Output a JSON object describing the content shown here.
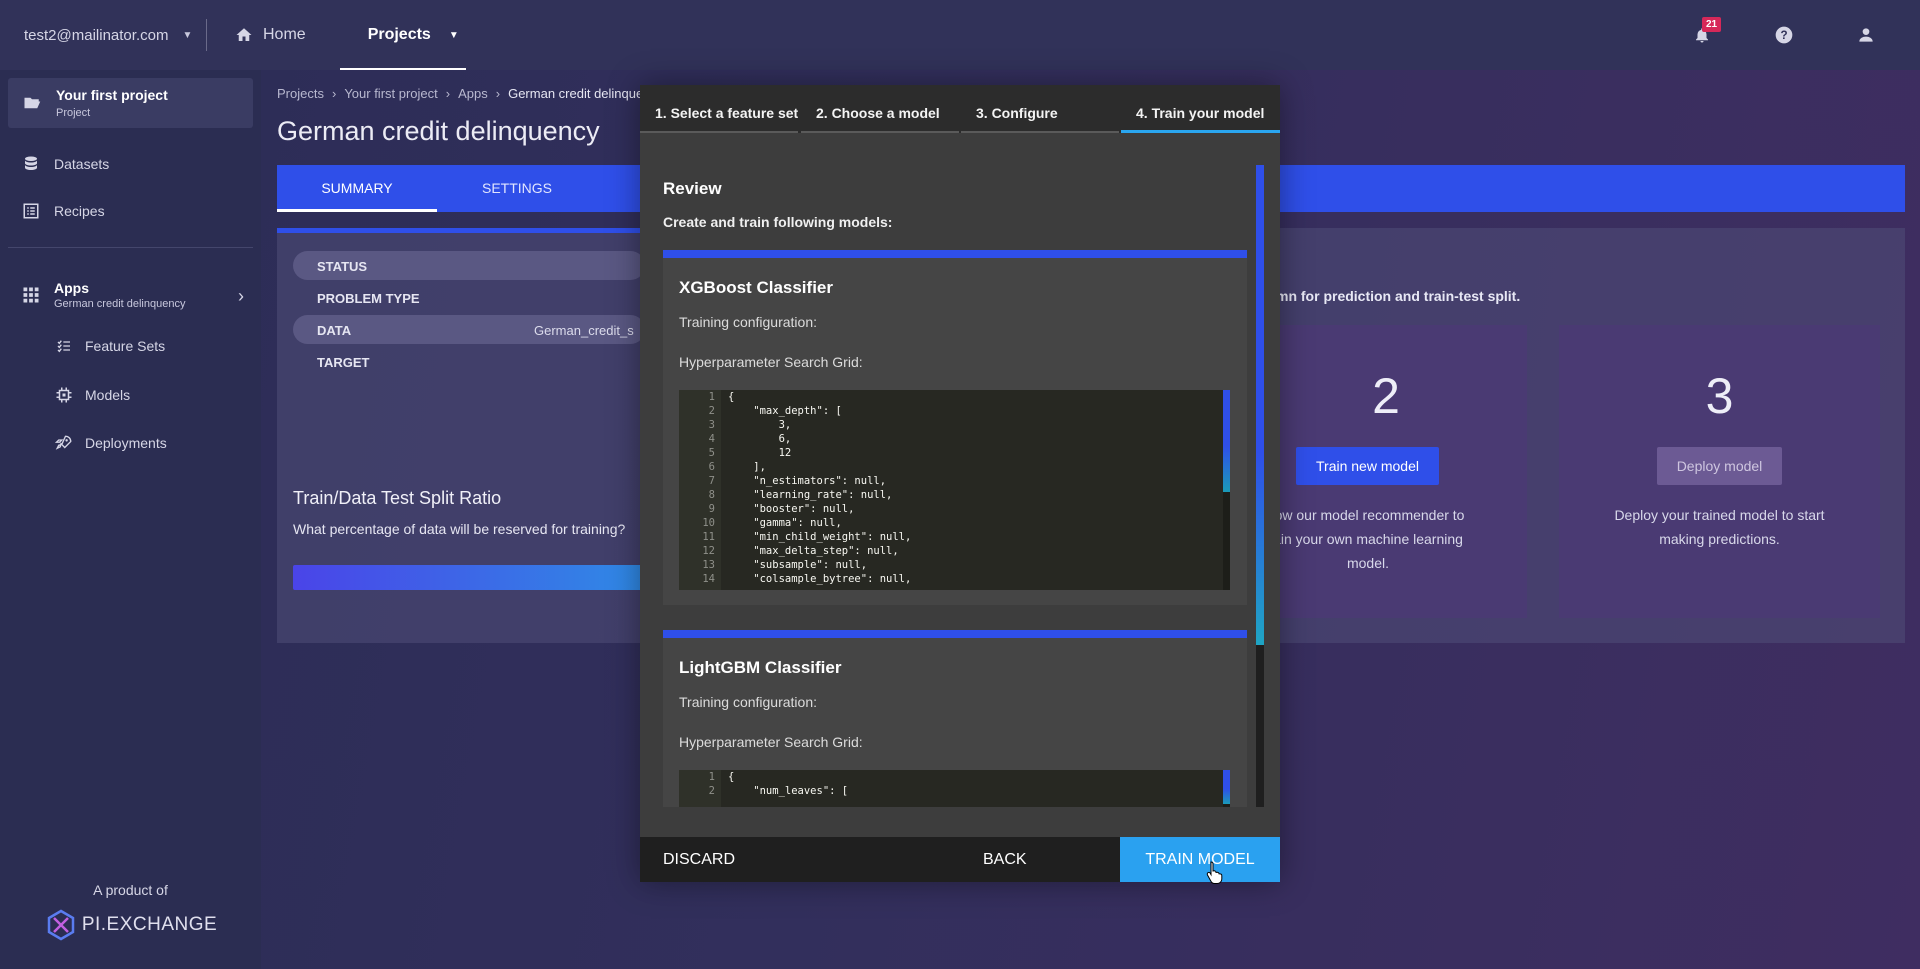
{
  "topbar": {
    "account": "test2@mailinator.com",
    "nav": [
      {
        "label": "Home",
        "icon": "home-icon"
      },
      {
        "label": "Projects",
        "icon": "folder-icon"
      }
    ],
    "notification_count": "21",
    "icons": [
      "bell-icon",
      "help-icon",
      "user-icon"
    ]
  },
  "sidebar": {
    "project_name": "Your first project",
    "project_sub": "Project",
    "items": [
      {
        "label": "Datasets",
        "icon": "database-icon"
      },
      {
        "label": "Recipes",
        "icon": "list-icon"
      }
    ],
    "apps_label": "Apps",
    "apps_sub": "German credit delinquency",
    "sub_items": [
      {
        "label": "Feature Sets",
        "icon": "feature-list-icon"
      },
      {
        "label": "Models",
        "icon": "chip-icon"
      },
      {
        "label": "Deployments",
        "icon": "rocket-icon"
      }
    ],
    "product_by": "A product of",
    "brand": "PI.EXCHANGE"
  },
  "main": {
    "breadcrumbs": [
      "Projects",
      "Your first project",
      "Apps",
      "German credit delinque"
    ],
    "title": "German credit delinquency",
    "tabs": [
      "SUMMARY",
      "SETTINGS"
    ],
    "details": [
      {
        "key": "STATUS",
        "value": ""
      },
      {
        "key": "PROBLEM TYPE",
        "value": ""
      },
      {
        "key": "DATA",
        "value": "German_credit_s"
      },
      {
        "key": "TARGET",
        "value": ""
      }
    ],
    "split_title": "Train/Data Test Split Ratio",
    "split_question": "What percentage of data will be reserved for training?",
    "hint": "mn for prediction and train-test split.",
    "steps": [
      {
        "num": "2",
        "button": "Train new model",
        "desc": [
          "low our model recommender to",
          "ain your own machine learning",
          "model."
        ]
      },
      {
        "num": "3",
        "button": "Deploy model",
        "desc": [
          "Deploy your trained model to start",
          "making predictions."
        ]
      }
    ]
  },
  "modal": {
    "tabs": [
      "1. Select a feature set",
      "2. Choose a model",
      "3. Configure",
      "4. Train your model"
    ],
    "review_title": "Review",
    "review_sub": "Create and train following models:",
    "models": [
      {
        "name": "XGBoost Classifier",
        "config_label": "Training configuration:",
        "grid_label": "Hyperparameter Search Grid:",
        "code_lines": [
          {
            "n": "1",
            "t": "{"
          },
          {
            "n": "2",
            "t": "    \"max_depth\": ["
          },
          {
            "n": "3",
            "t": "        3,"
          },
          {
            "n": "4",
            "t": "        6,"
          },
          {
            "n": "5",
            "t": "        12"
          },
          {
            "n": "6",
            "t": "    ],"
          },
          {
            "n": "7",
            "t": "    \"n_estimators\": null,"
          },
          {
            "n": "8",
            "t": "    \"learning_rate\": null,"
          },
          {
            "n": "9",
            "t": "    \"booster\": null,"
          },
          {
            "n": "10",
            "t": "    \"gamma\": null,"
          },
          {
            "n": "11",
            "t": "    \"min_child_weight\": null,"
          },
          {
            "n": "12",
            "t": "    \"max_delta_step\": null,"
          },
          {
            "n": "13",
            "t": "    \"subsample\": null,"
          },
          {
            "n": "14",
            "t": "    \"colsample_bytree\": null,"
          }
        ]
      },
      {
        "name": "LightGBM Classifier",
        "config_label": "Training configuration:",
        "grid_label": "Hyperparameter Search Grid:",
        "code_lines": [
          {
            "n": "1",
            "t": "{"
          },
          {
            "n": "2",
            "t": "    \"num_leaves\": ["
          }
        ]
      }
    ],
    "footer": {
      "discard": "DISCARD",
      "back": "BACK",
      "train": "TRAIN MODEL"
    }
  },
  "colors": {
    "accent": "#2f4fe9",
    "train_button": "#2aa1f0",
    "badge": "#d62859"
  }
}
